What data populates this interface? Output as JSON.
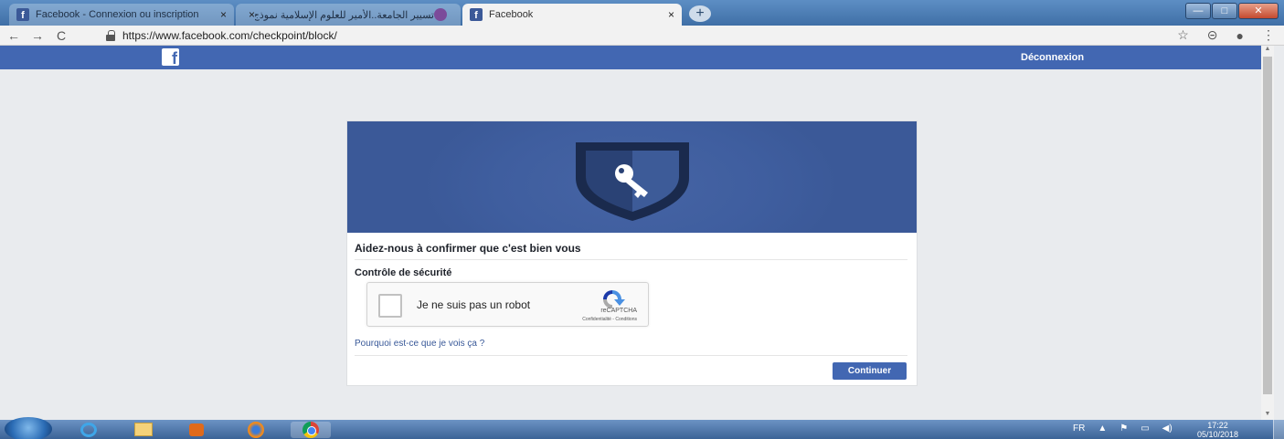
{
  "browser": {
    "tabs": [
      {
        "title": "Facebook - Connexion ou inscription",
        "favicon": "facebook-favicon",
        "active": false
      },
      {
        "title": "تسيير الجامعة..الأمير للعلوم الإسلامية نموذج",
        "favicon": "globe-favicon",
        "active": false
      },
      {
        "title": "Facebook",
        "favicon": "facebook-favicon",
        "active": true
      }
    ],
    "close_glyph": "×",
    "new_tab_glyph": "+",
    "url": "https://www.facebook.com/checkpoint/block/",
    "window_buttons": {
      "minimize": "—",
      "maximize": "□",
      "close": "✕"
    },
    "nav_glyphs": {
      "back": "←",
      "forward": "→",
      "reload": "C"
    },
    "toolbar_glyphs": {
      "star": "☆",
      "extension": "⊝",
      "account": "●",
      "menu": "⋮"
    }
  },
  "facebook": {
    "logo": "f",
    "logout_label": "Déconnexion",
    "brand_color": "#4267b2"
  },
  "checkpoint": {
    "heading": "Aidez-nous à confirmer que c'est bien vous",
    "security_label": "Contrôle de sécurité",
    "captcha": {
      "label": "Je ne suis pas un robot",
      "brand": "reCAPTCHA",
      "legal": "Confidentialité - Conditions",
      "checked": false
    },
    "why_link": "Pourquoi est-ce que je vois ça ?",
    "continue_label": "Continuer",
    "hero_icon": "shield-key-icon"
  },
  "taskbar": {
    "apps": [
      "start-orb-icon",
      "internet-explorer-icon",
      "file-manager-icon",
      "media-player-icon",
      "firefox-icon",
      "chrome-icon"
    ],
    "language": "FR",
    "tray_glyphs": {
      "expand": "▲",
      "flag": "⚑",
      "network": "▭",
      "volume": "◀)"
    },
    "time": "17:22",
    "date": "05/10/2018"
  }
}
